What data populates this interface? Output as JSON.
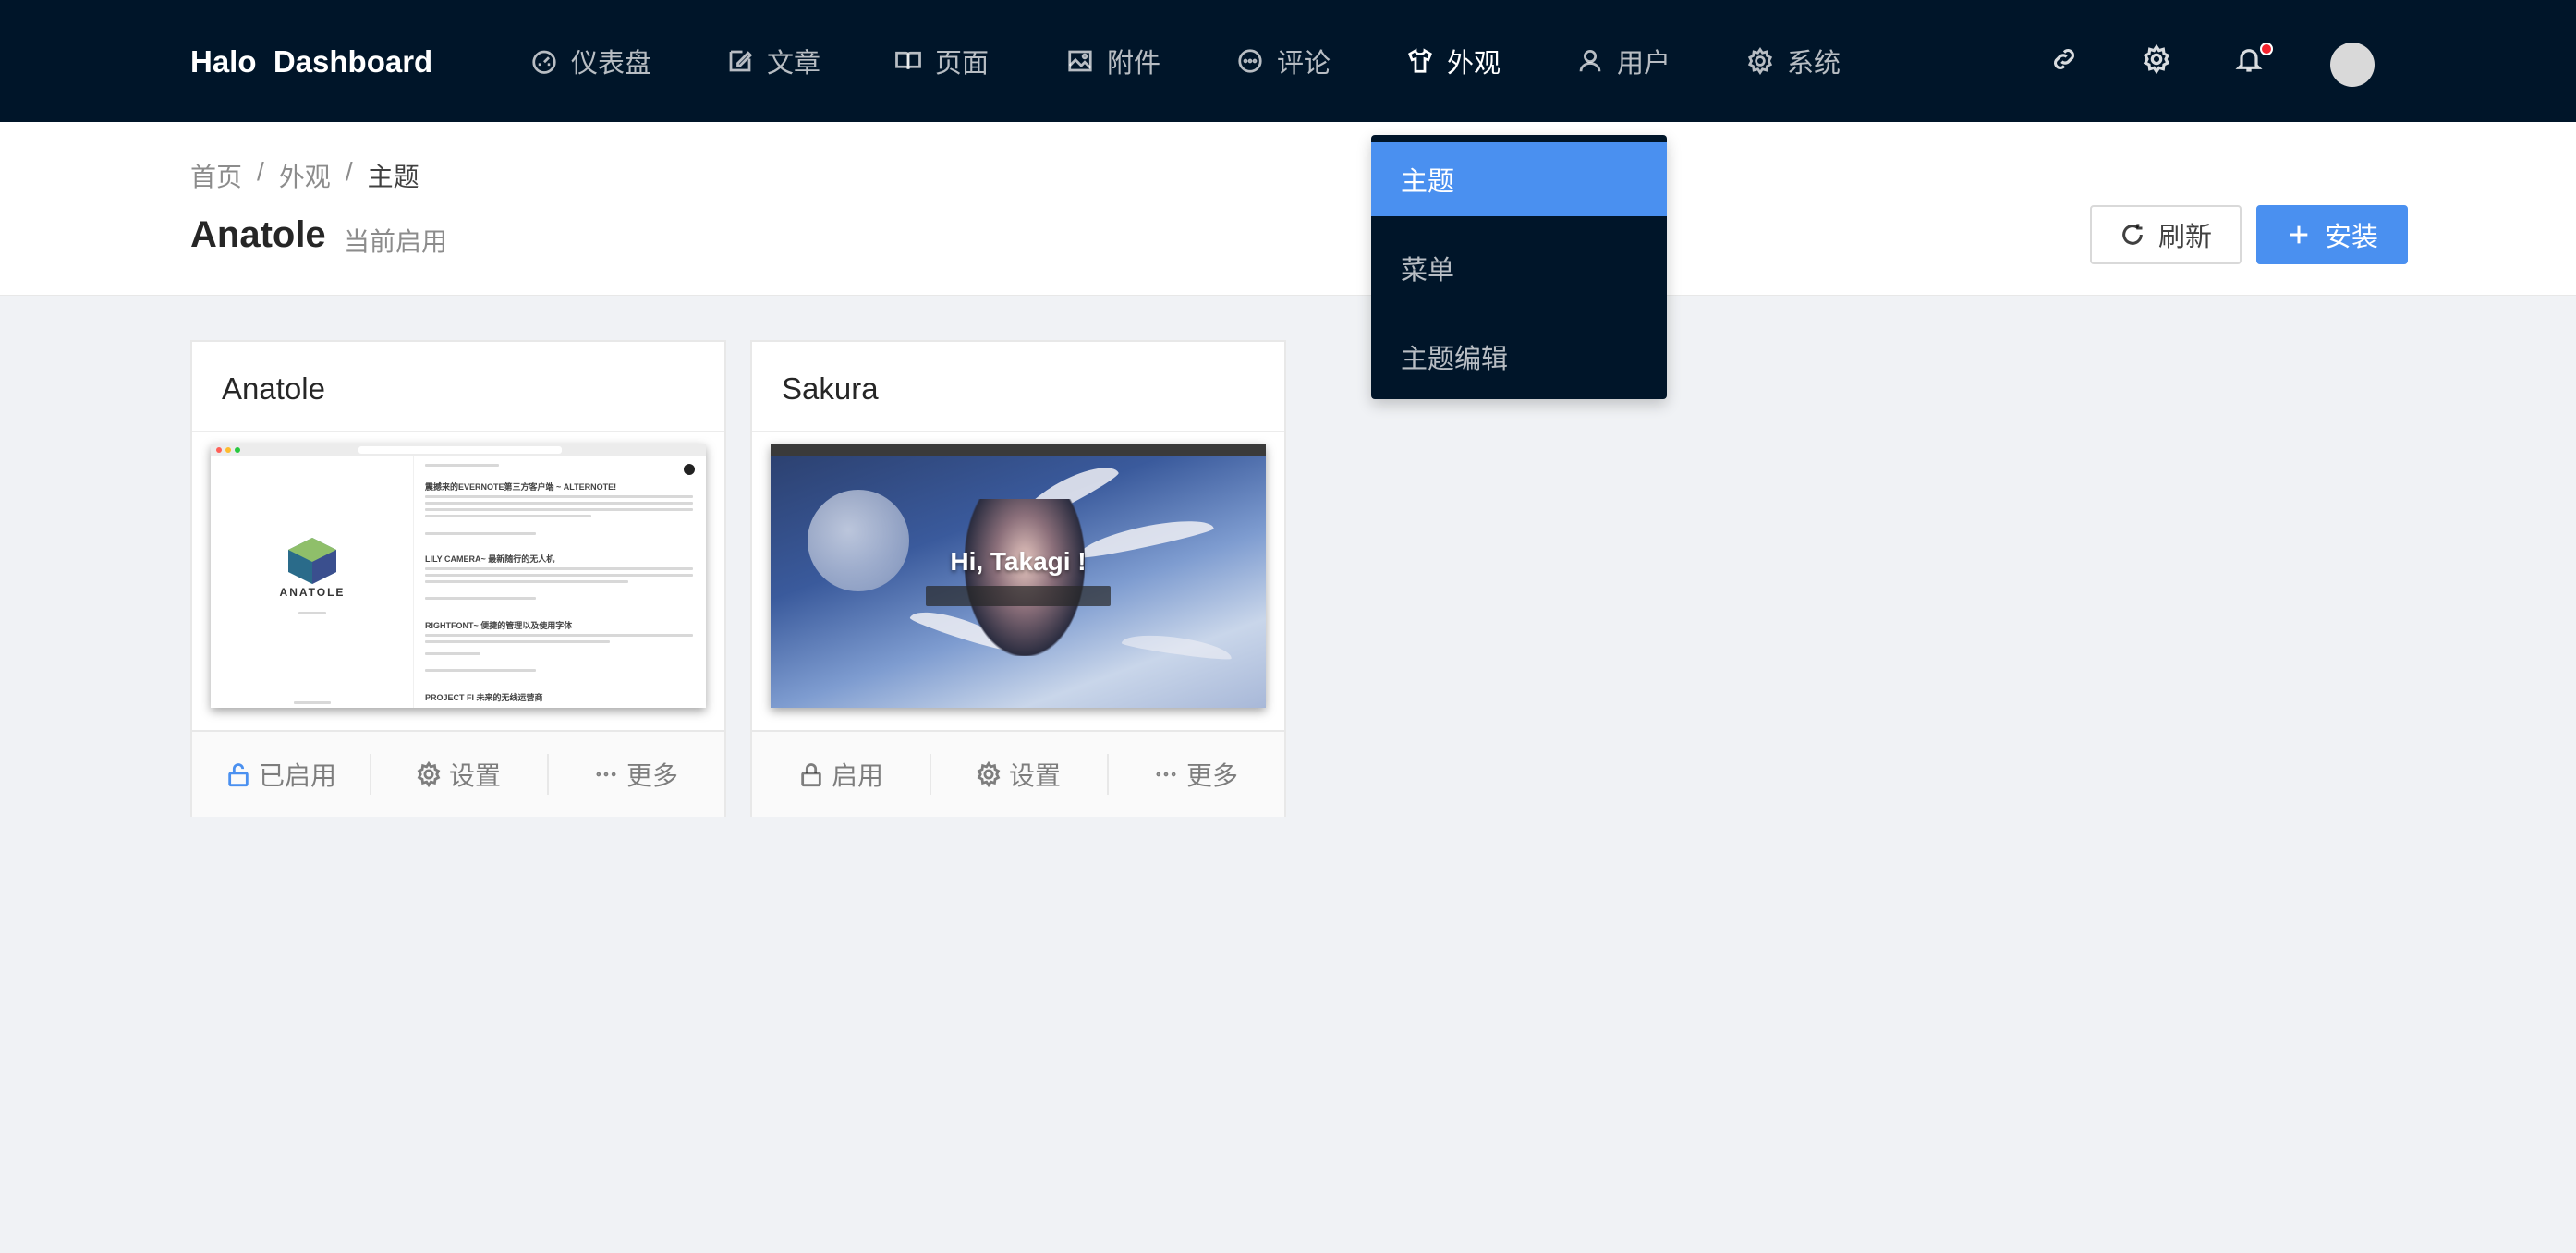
{
  "app": {
    "brand": "Halo  Dashboard"
  },
  "nav": {
    "items": [
      {
        "label": "仪表盘",
        "icon": "dashboard-icon"
      },
      {
        "label": "文章",
        "icon": "edit-icon"
      },
      {
        "label": "页面",
        "icon": "book-icon"
      },
      {
        "label": "附件",
        "icon": "picture-icon"
      },
      {
        "label": "评论",
        "icon": "comment-icon"
      },
      {
        "label": "外观",
        "icon": "skin-icon",
        "active": true
      },
      {
        "label": "用户",
        "icon": "user-icon"
      },
      {
        "label": "系统",
        "icon": "setting-icon"
      }
    ]
  },
  "toolbar": {
    "icons": [
      "link-icon",
      "gear-icon",
      "bell-icon"
    ],
    "has_notification": true
  },
  "dropdown": {
    "items": [
      {
        "label": "主题",
        "active": true
      },
      {
        "label": "菜单"
      },
      {
        "label": "主题编辑"
      }
    ]
  },
  "breadcrumb": {
    "items": [
      "首页",
      "外观",
      "主题"
    ],
    "separator": "/"
  },
  "page": {
    "title": "Anatole",
    "subtitle": "当前启用",
    "refresh_label": "刷新",
    "install_label": "安装"
  },
  "themes": [
    {
      "name": "Anatole",
      "actions": {
        "enable": "已启用",
        "settings": "设置",
        "more": "更多"
      },
      "enabled": true,
      "cover": {
        "logo_text": "ANATOLE",
        "posts": [
          "震撼来的EVERNOTE第三方客户端 ~ ALTERNOTE!",
          "LILY CAMERA~ 最新随行的无人机",
          "RIGHTFONT~ 便捷的管理以及使用字体",
          "PROJECT FI 未来的无线运营商"
        ]
      }
    },
    {
      "name": "Sakura",
      "actions": {
        "enable": "启用",
        "settings": "设置",
        "more": "更多"
      },
      "enabled": false,
      "cover": {
        "headline": "Hi, Takagi !"
      }
    }
  ],
  "colors": {
    "nav_bg": "#001529",
    "primary": "#4a90f0",
    "page_bg": "#f0f2f5",
    "notification": "#f5222d"
  }
}
